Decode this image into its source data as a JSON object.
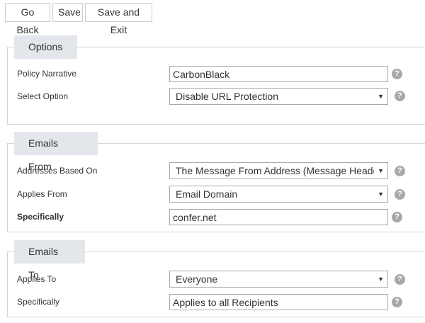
{
  "toolbar": {
    "go_back_label": "Go Back",
    "save_label": "Save",
    "save_exit_label": "Save and Exit"
  },
  "options": {
    "title": "Options",
    "policy_narrative": {
      "label": "Policy Narrative",
      "value": "CarbonBlack"
    },
    "select_option": {
      "label": "Select Option",
      "value": "Disable URL Protection"
    }
  },
  "emails_from": {
    "title": "Emails From",
    "addresses_based_on": {
      "label": "Addresses Based On",
      "value": "The Message From Address (Message Header"
    },
    "applies_from": {
      "label": "Applies From",
      "value": "Email Domain"
    },
    "specifically": {
      "label": "Specifically",
      "value": "confer.net"
    }
  },
  "emails_to": {
    "title": "Emails To",
    "applies_to": {
      "label": "Applies To",
      "value": "Everyone"
    },
    "specifically": {
      "label": "Specifically",
      "value": "Applies to all Recipients"
    }
  },
  "help_glyph": "?",
  "dropdown_glyph": "▼"
}
